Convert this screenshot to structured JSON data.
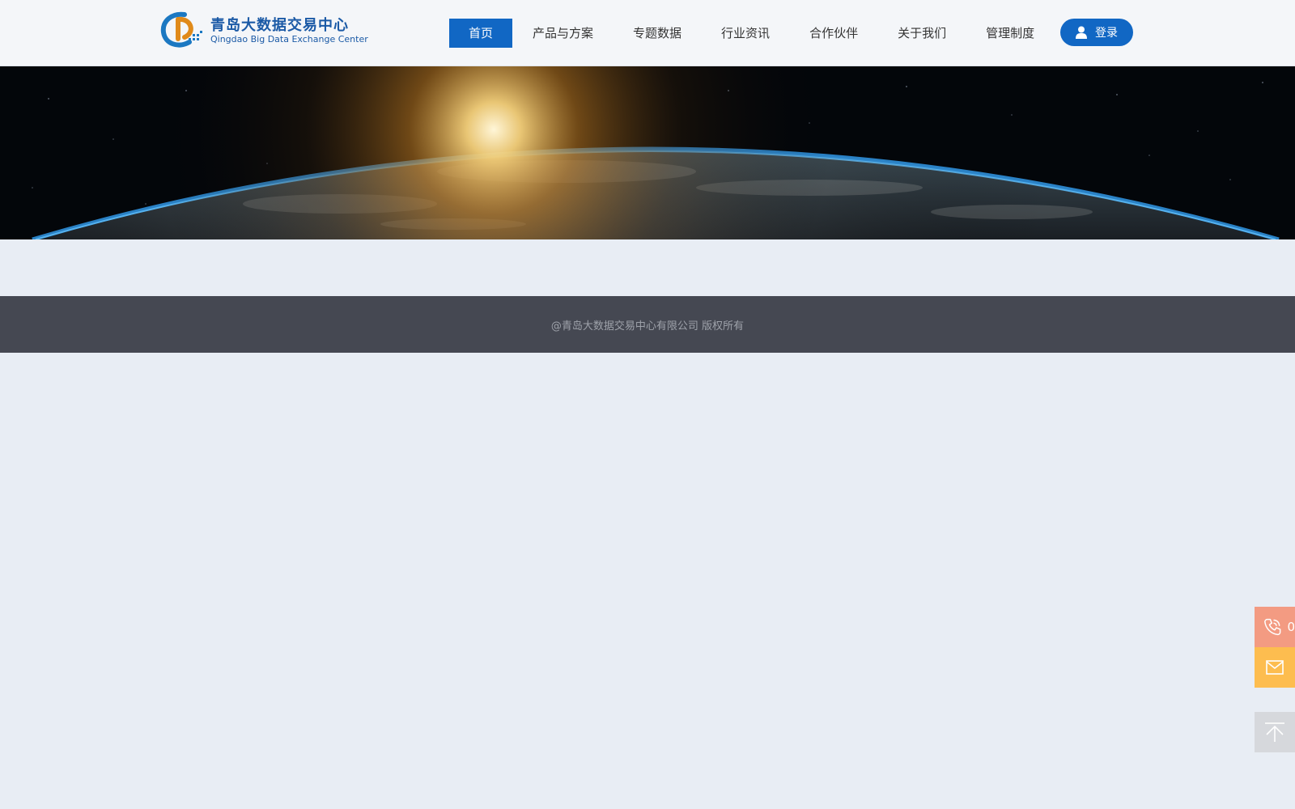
{
  "brand": {
    "name_cn": "青岛大数据交易中心",
    "name_en": "Qingdao Big Data Exchange Center",
    "color": "#1b5aa6",
    "accent": "#e08a1a"
  },
  "nav": {
    "items": [
      {
        "label": "首页",
        "active": true
      },
      {
        "label": "产品与方案",
        "active": false
      },
      {
        "label": "专题数据",
        "active": false
      },
      {
        "label": "行业资讯",
        "active": false
      },
      {
        "label": "合作伙伴",
        "active": false
      },
      {
        "label": "关于我们",
        "active": false
      },
      {
        "label": "管理制度",
        "active": false
      }
    ],
    "active_color": "#1167c4"
  },
  "login": {
    "label": "登录",
    "icon": "user-icon"
  },
  "banner": {
    "image": "earth-horizon-sunrise"
  },
  "footer": {
    "copyright": "@青岛大数据交易中心有限公司 版权所有",
    "background": "#454852"
  },
  "float_bar": {
    "phone": {
      "icon": "phone-icon",
      "text": "0",
      "color": "#f39b82"
    },
    "mail": {
      "icon": "mail-icon",
      "color": "#fdbd4f"
    },
    "top": {
      "icon": "back-to-top-icon",
      "color": "#d6d8dc"
    }
  }
}
